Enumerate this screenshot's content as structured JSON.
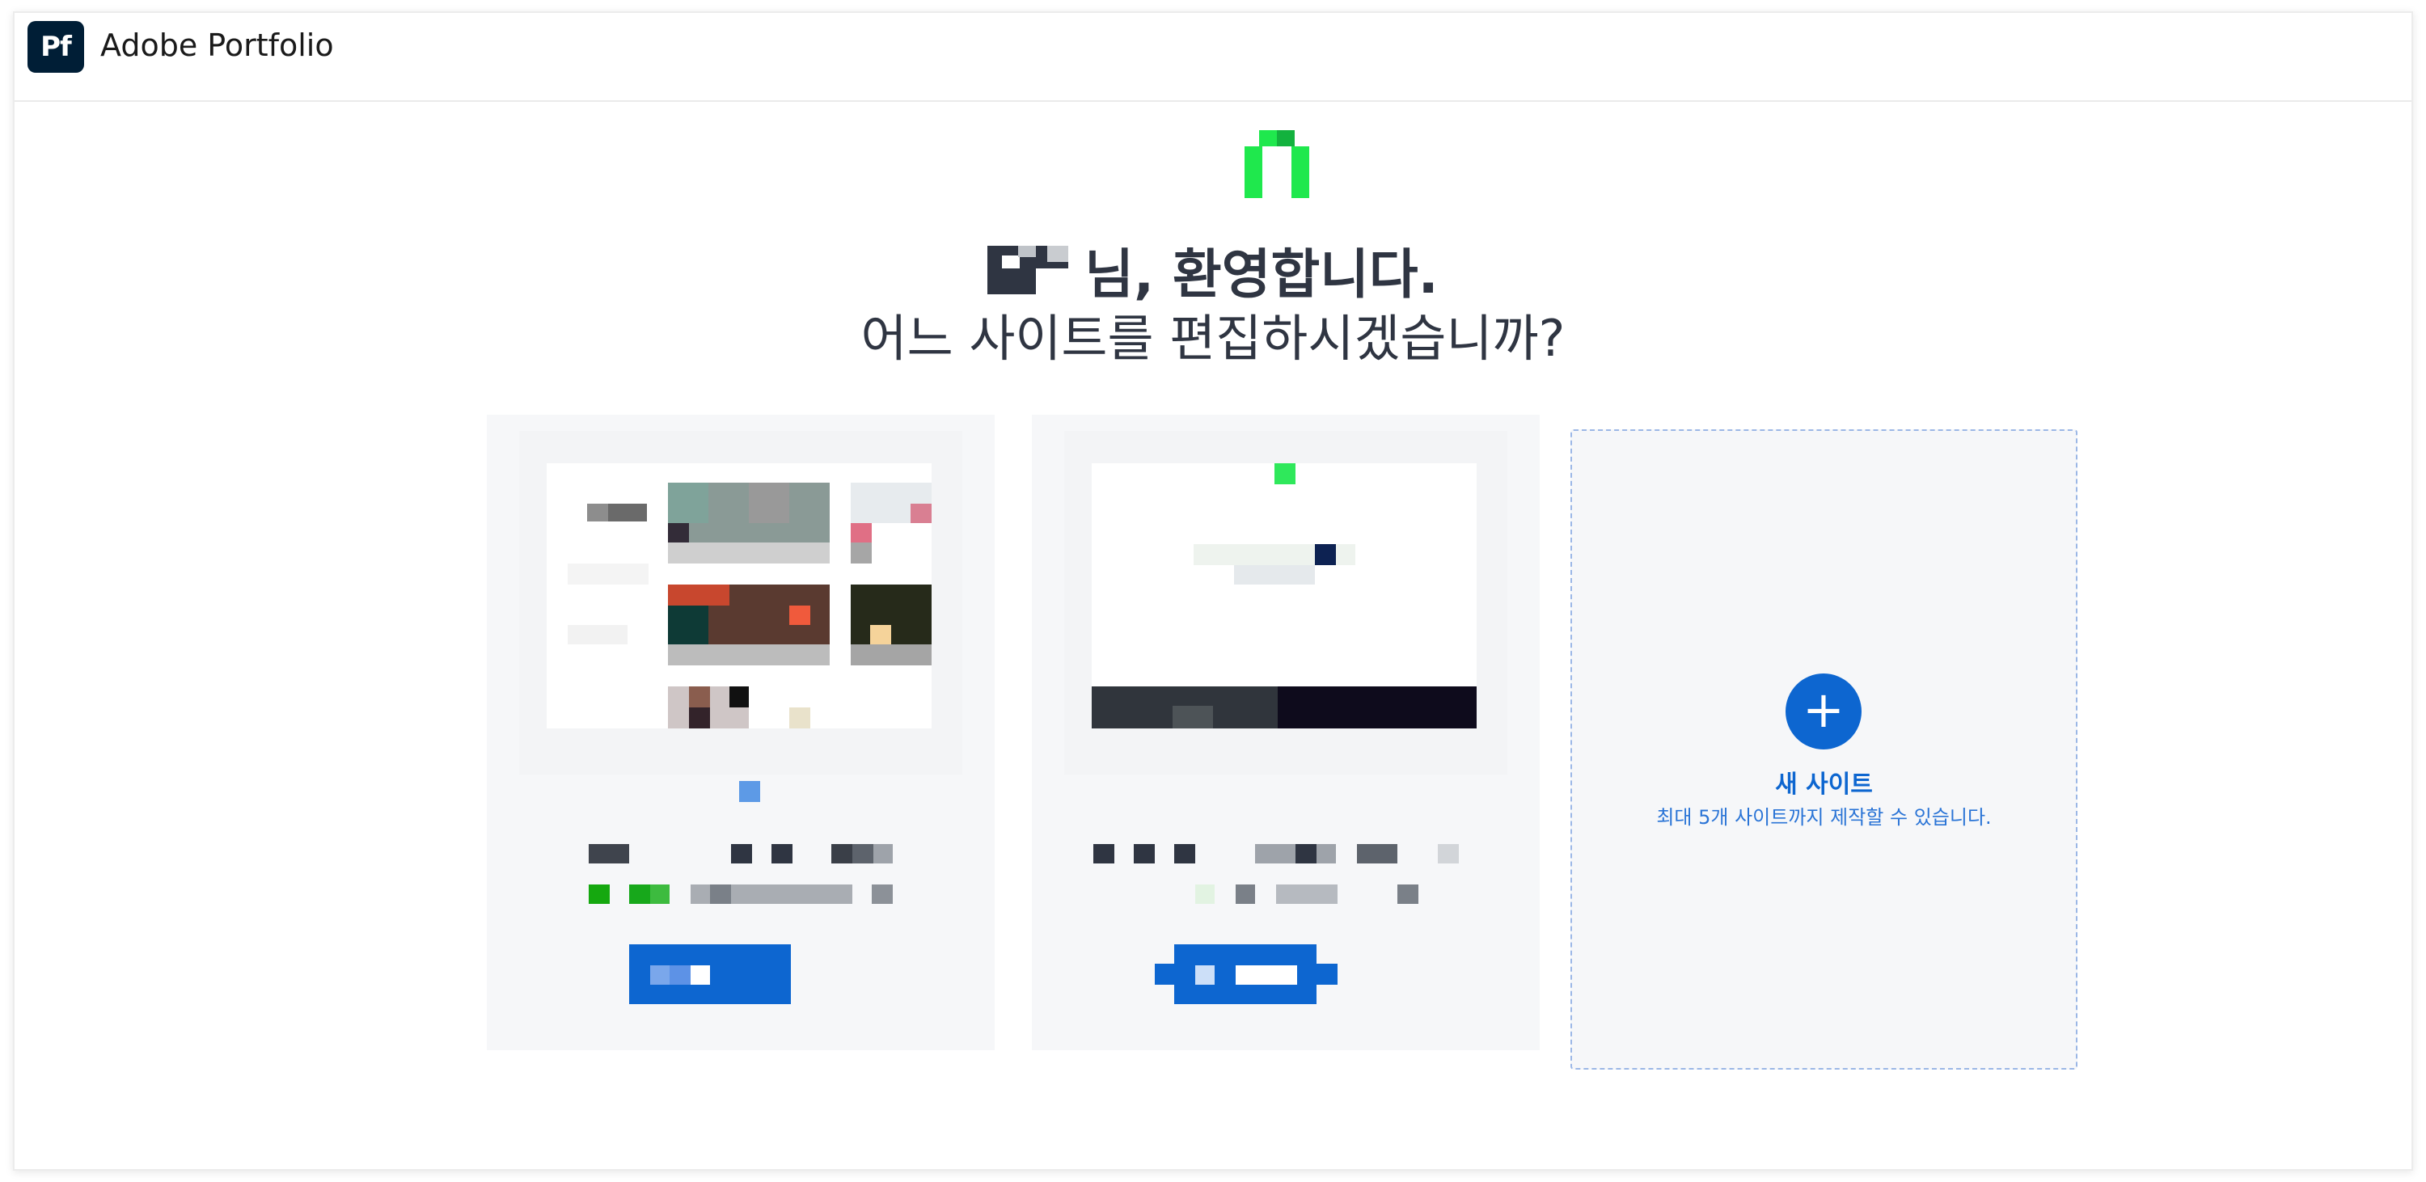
{
  "header": {
    "logo_text": "Pf",
    "title": "Adobe Portfolio"
  },
  "greeting": {
    "suffix": "님, 환영합니다.",
    "question": "어느 사이트를 편집하시겠습니까?"
  },
  "sites": [
    {
      "thumbnail": "redacted-site-thumbnail-1"
    },
    {
      "thumbnail": "redacted-site-thumbnail-2"
    }
  ],
  "new_site": {
    "icon": "plus-icon",
    "title": "새 사이트",
    "subtitle": "최대 5개 사이트까지 제작할 수 있습니다."
  },
  "colors": {
    "accent": "#0d66d0",
    "logo_bg": "#001e36",
    "avatar_green": "#1fe84d",
    "card_bg": "#f6f7f9"
  }
}
